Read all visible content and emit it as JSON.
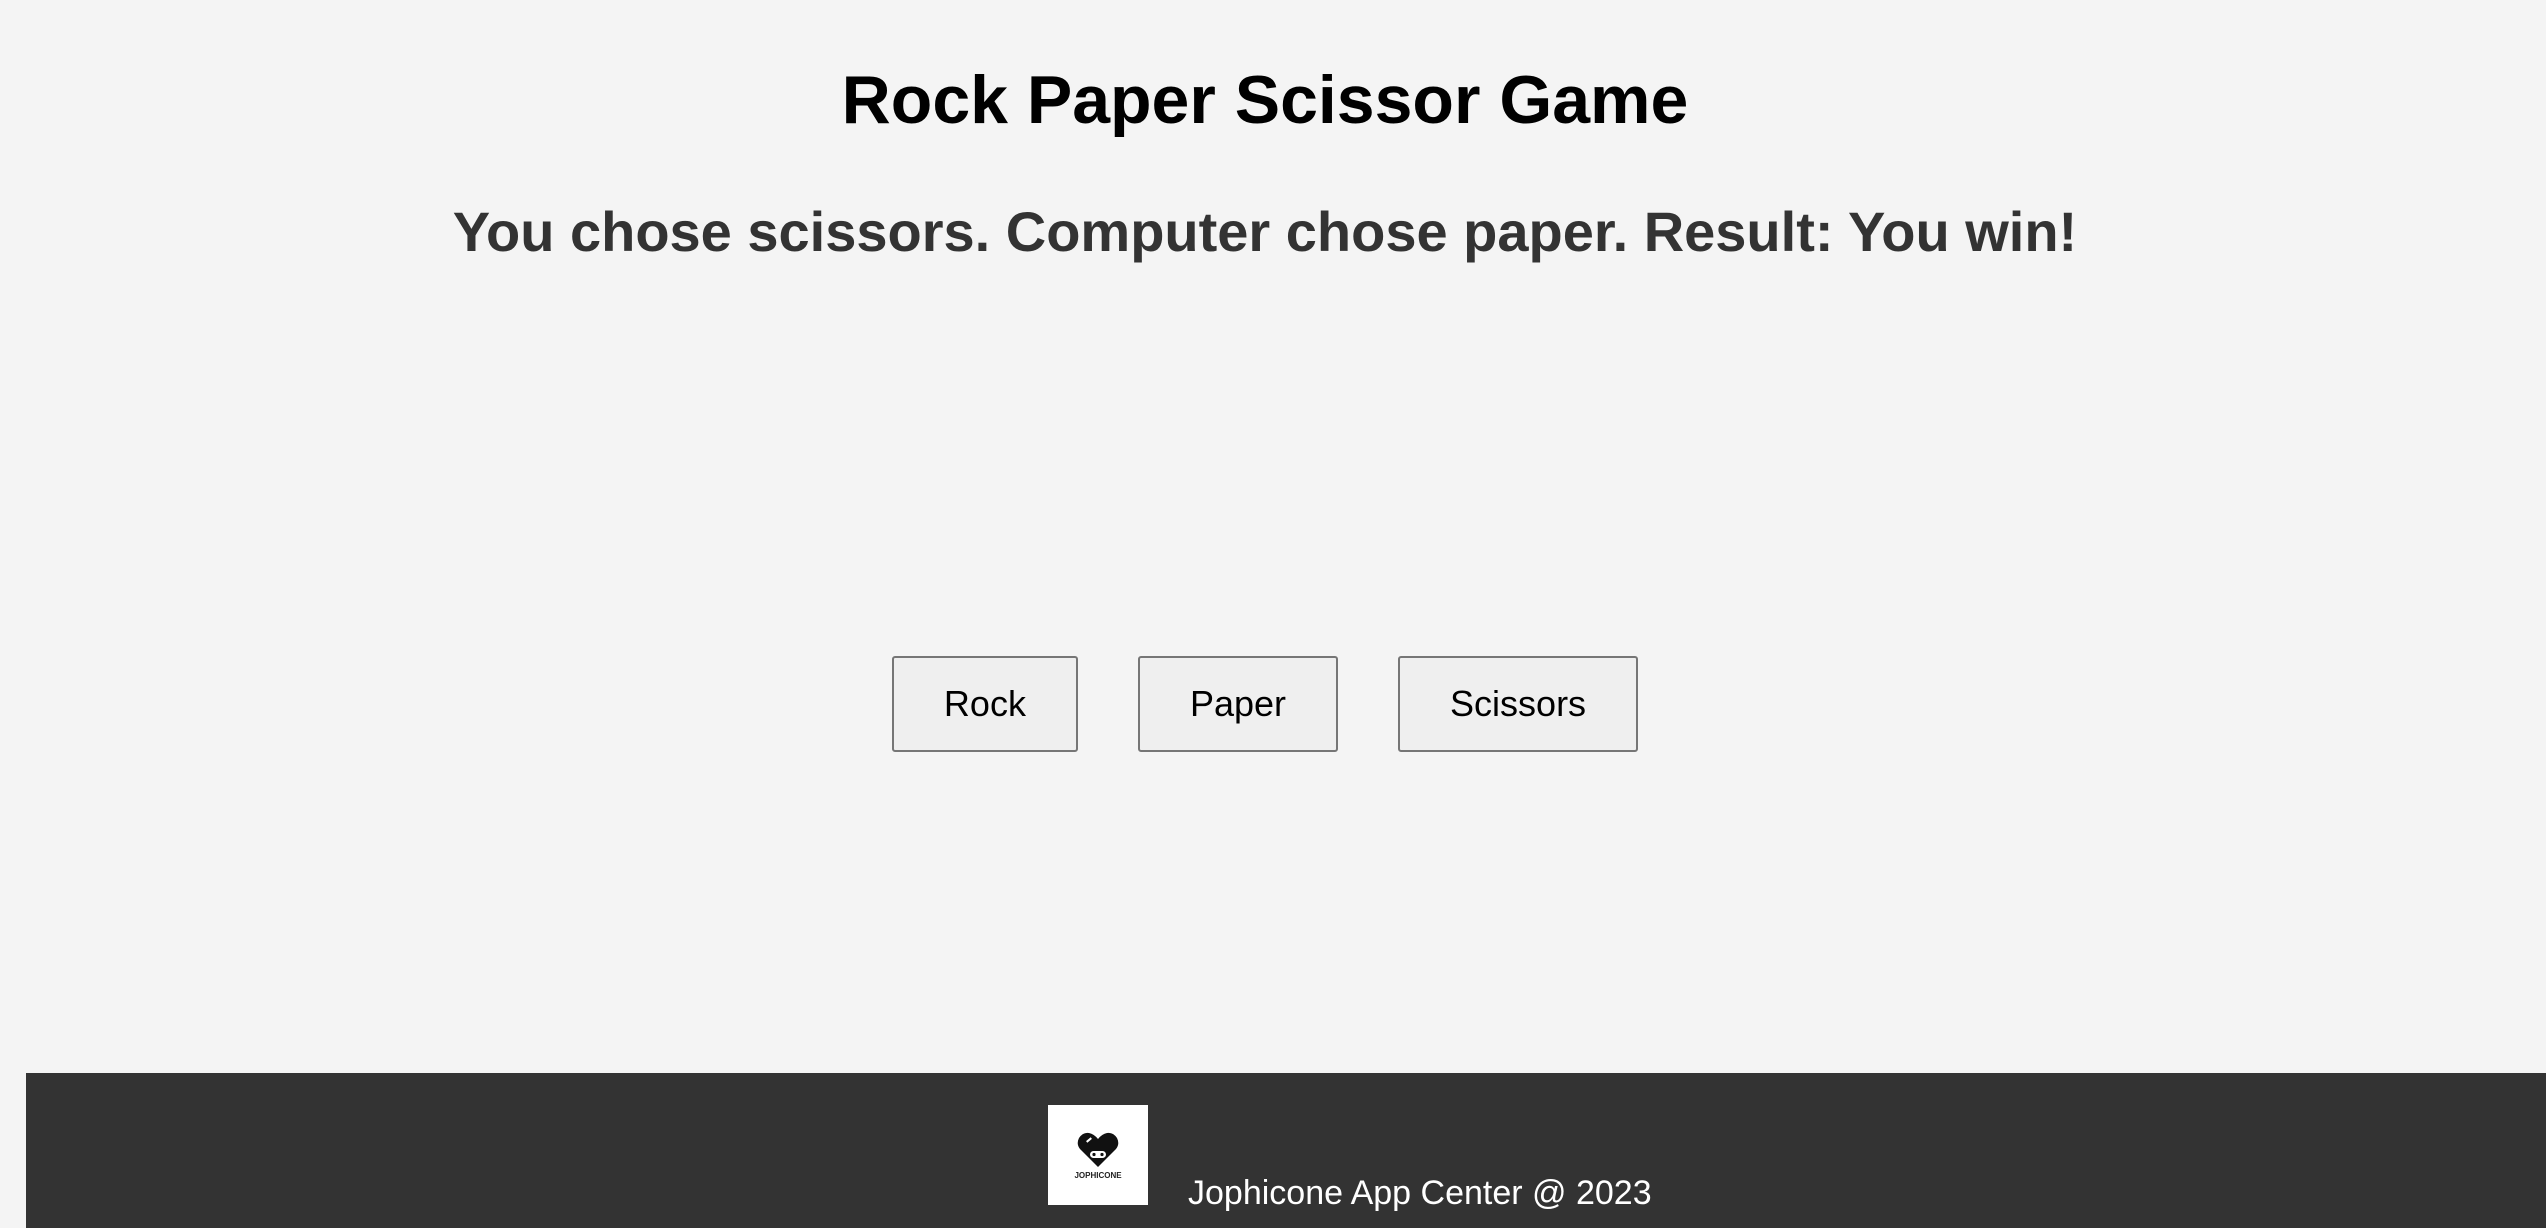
{
  "header": {
    "title": "Rock Paper Scissor Game"
  },
  "result": {
    "text": "You chose scissors. Computer chose paper. Result: You win!"
  },
  "choices": [
    {
      "label": "Rock"
    },
    {
      "label": "Paper"
    },
    {
      "label": "Scissors"
    }
  ],
  "footer": {
    "logo_text": "JOPHICONE",
    "copyright": "Jophicone App Center @ 2023",
    "logo_icon": "heart-gamepad-logo"
  },
  "colors": {
    "background": "#f4f4f4",
    "footer_background": "#333333",
    "result_text": "#333333"
  }
}
